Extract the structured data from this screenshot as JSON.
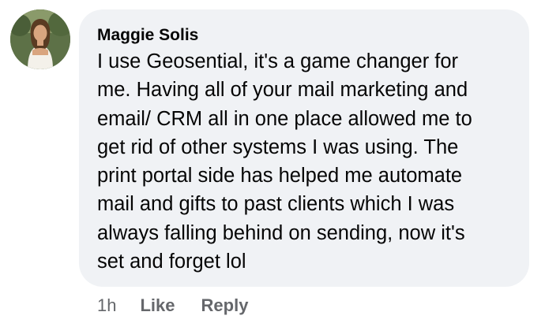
{
  "comment": {
    "author": "Maggie Solis",
    "lines": [
      "I use Geosential, it's a game changer for",
      "me. Having all of your mail marketing and",
      "email/ CRM all in one place allowed me to",
      "get rid of other systems I was using. The",
      "print portal side has helped me automate",
      "mail and gifts to past clients which I was",
      "always falling behind on sending, now it's",
      "set and forget lol"
    ],
    "time": "1h",
    "like_label": "Like",
    "reply_label": "Reply"
  },
  "colors": {
    "bubble_bg": "#f0f2f5",
    "text": "#050505",
    "meta_text": "#65676b"
  },
  "icons": {
    "avatar": "profile-photo"
  }
}
